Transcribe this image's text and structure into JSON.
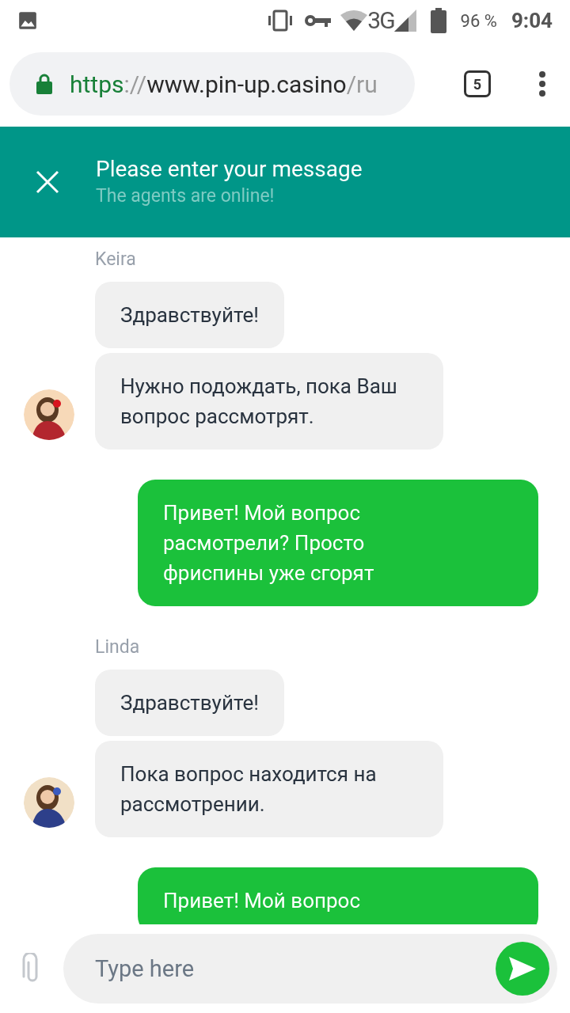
{
  "status_bar": {
    "battery": "96 %",
    "network": "3G",
    "time": "9:04"
  },
  "address_bar": {
    "scheme": "https",
    "separator": "://",
    "host": "www.pin-up.casino",
    "path": "/ru",
    "tab_count": "5"
  },
  "chat_header": {
    "title": "Please enter your message",
    "subtitle": "The agents are online!"
  },
  "messages": [
    {
      "kind": "agent",
      "name": "Keira",
      "bubbles": [
        "Здравствуйте!",
        "Нужно подождать, пока Ваш вопрос рассмотрят."
      ]
    },
    {
      "kind": "user",
      "text": "Привет! Мой вопрос расмотрели? Просто фриспины уже сгорят"
    },
    {
      "kind": "agent",
      "name": "Linda",
      "bubbles": [
        "Здравствуйте!",
        "Пока вопрос находится на рассмотрении."
      ]
    },
    {
      "kind": "user",
      "text": "Привет! Мой вопрос"
    }
  ],
  "composer": {
    "placeholder": "Type here"
  }
}
